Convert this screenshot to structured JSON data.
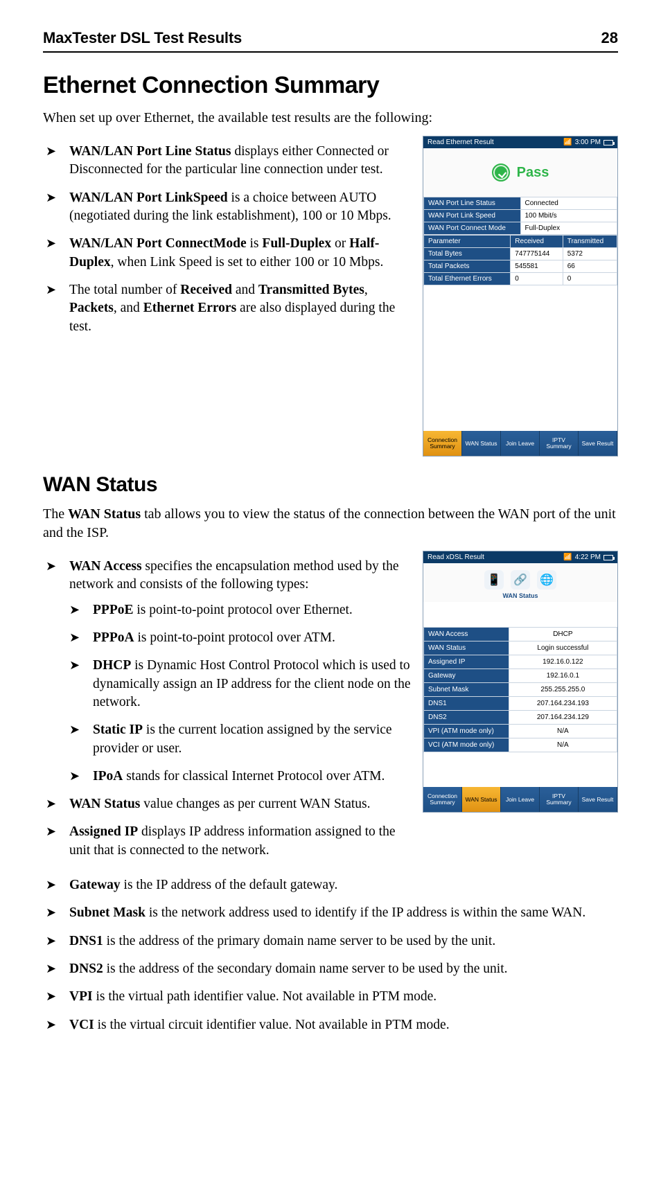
{
  "header": {
    "title": "MaxTester DSL Test Results",
    "page": "28"
  },
  "s1": {
    "heading": "Ethernet Connection Summary",
    "intro": "When set up over Ethernet, the available test results are the following:",
    "items": [
      {
        "b": "WAN/LAN Port Line Status",
        "t": " displays either Connected or Disconnected for the particular line connection under test."
      },
      {
        "b": "WAN/LAN Port LinkSpeed",
        "t": " is a choice between AUTO (negotiated during the link establishment), 100 or 10 Mbps."
      },
      {
        "pre": "",
        "b": "WAN/LAN Port ConnectMode",
        "mid": " is ",
        "b2": "Full-Duplex",
        "mid2": " or ",
        "b3": "Half-Duplex",
        "t": ", when Link Speed is set to either 100 or 10 Mbps."
      },
      {
        "pre": "The total number of ",
        "b": "Received",
        "mid": " and ",
        "b2": "Transmitted Bytes",
        "mid2": ", ",
        "b3": "Packets",
        "mid3": ", and ",
        "b4": "Ethernet Errors",
        "t": " are also displayed during the test."
      }
    ]
  },
  "fig1": {
    "title": "Read Ethernet Result",
    "time": "3:00 PM",
    "pass": "Pass",
    "rows": [
      {
        "k": "WAN Port Line Status",
        "v": "Connected"
      },
      {
        "k": "WAN Port Link Speed",
        "v": "100 Mbit/s"
      },
      {
        "k": "WAN Port Connect Mode",
        "v": "Full-Duplex"
      }
    ],
    "cols": {
      "param": "Parameter",
      "rx": "Received",
      "tx": "Transmitted"
    },
    "data": [
      {
        "k": "Total Bytes",
        "rx": "747775144",
        "tx": "5372"
      },
      {
        "k": "Total Packets",
        "rx": "545581",
        "tx": "66"
      },
      {
        "k": "Total Ethernet Errors",
        "rx": "0",
        "tx": "0"
      }
    ],
    "tabs": [
      "Connection Summary",
      "WAN Status",
      "Join Leave",
      "IPTV Summary",
      "Save Result"
    ]
  },
  "s2": {
    "heading": "WAN Status",
    "intro_pre": "The ",
    "intro_b": "WAN Status",
    "intro_post": " tab allows you to view the status of the connection between the WAN port of the unit and the ISP.",
    "items": {
      "access_b": "WAN Access",
      "access_t": " specifies the encapsulation method used by the network and consists of the following types:",
      "sub": [
        {
          "b": "PPPoE",
          "t": " is point-to-point protocol over Ethernet."
        },
        {
          "b": "PPPoA",
          "t": " is point-to-point protocol over ATM."
        },
        {
          "b": "DHCP",
          "t": " is Dynamic Host Control Protocol which is used to dynamically assign an IP address for the client node on the network."
        },
        {
          "b": "Static IP",
          "t": " is the current location assigned by the service provider or user."
        },
        {
          "b": "IPoA",
          "t": " stands for classical Internet Protocol over ATM."
        }
      ],
      "rest": [
        {
          "b": "WAN Status",
          "t": " value changes as per current WAN Status."
        },
        {
          "b": "Assigned IP",
          "t": " displays IP address information assigned to the unit that is connected to the network."
        },
        {
          "b": "Gateway",
          "t": " is the IP address of the default gateway."
        },
        {
          "b": "Subnet Mask",
          "t": " is the network address used to identify if the IP address is within the same WAN."
        },
        {
          "b": "DNS1",
          "t": " is the address of the primary domain name server to be used by the unit."
        },
        {
          "b": "DNS2",
          "t": " is the address of the secondary domain name server to be used by the unit."
        },
        {
          "b": "VPI",
          "t": " is the virtual path identifier value. Not available in PTM mode."
        },
        {
          "b": "VCI",
          "t": " is the virtual circuit identifier value. Not available in PTM mode."
        }
      ]
    }
  },
  "fig2": {
    "title": "Read xDSL Result",
    "time": "4:22 PM",
    "label": "WAN Status",
    "rows": [
      {
        "k": "WAN Access",
        "v": "DHCP"
      },
      {
        "k": "WAN Status",
        "v": "Login successful"
      },
      {
        "k": "Assigned IP",
        "v": "192.16.0.122"
      },
      {
        "k": "Gateway",
        "v": "192.16.0.1"
      },
      {
        "k": "Subnet Mask",
        "v": "255.255.255.0"
      },
      {
        "k": "DNS1",
        "v": "207.164.234.193"
      },
      {
        "k": "DNS2",
        "v": "207.164.234.129"
      },
      {
        "k": "VPI (ATM mode only)",
        "v": "N/A"
      },
      {
        "k": "VCI (ATM mode only)",
        "v": "N/A"
      }
    ],
    "tabs": [
      "Connection Summary",
      "WAN Status",
      "Join Leave",
      "IPTV Summary",
      "Save Result"
    ]
  }
}
